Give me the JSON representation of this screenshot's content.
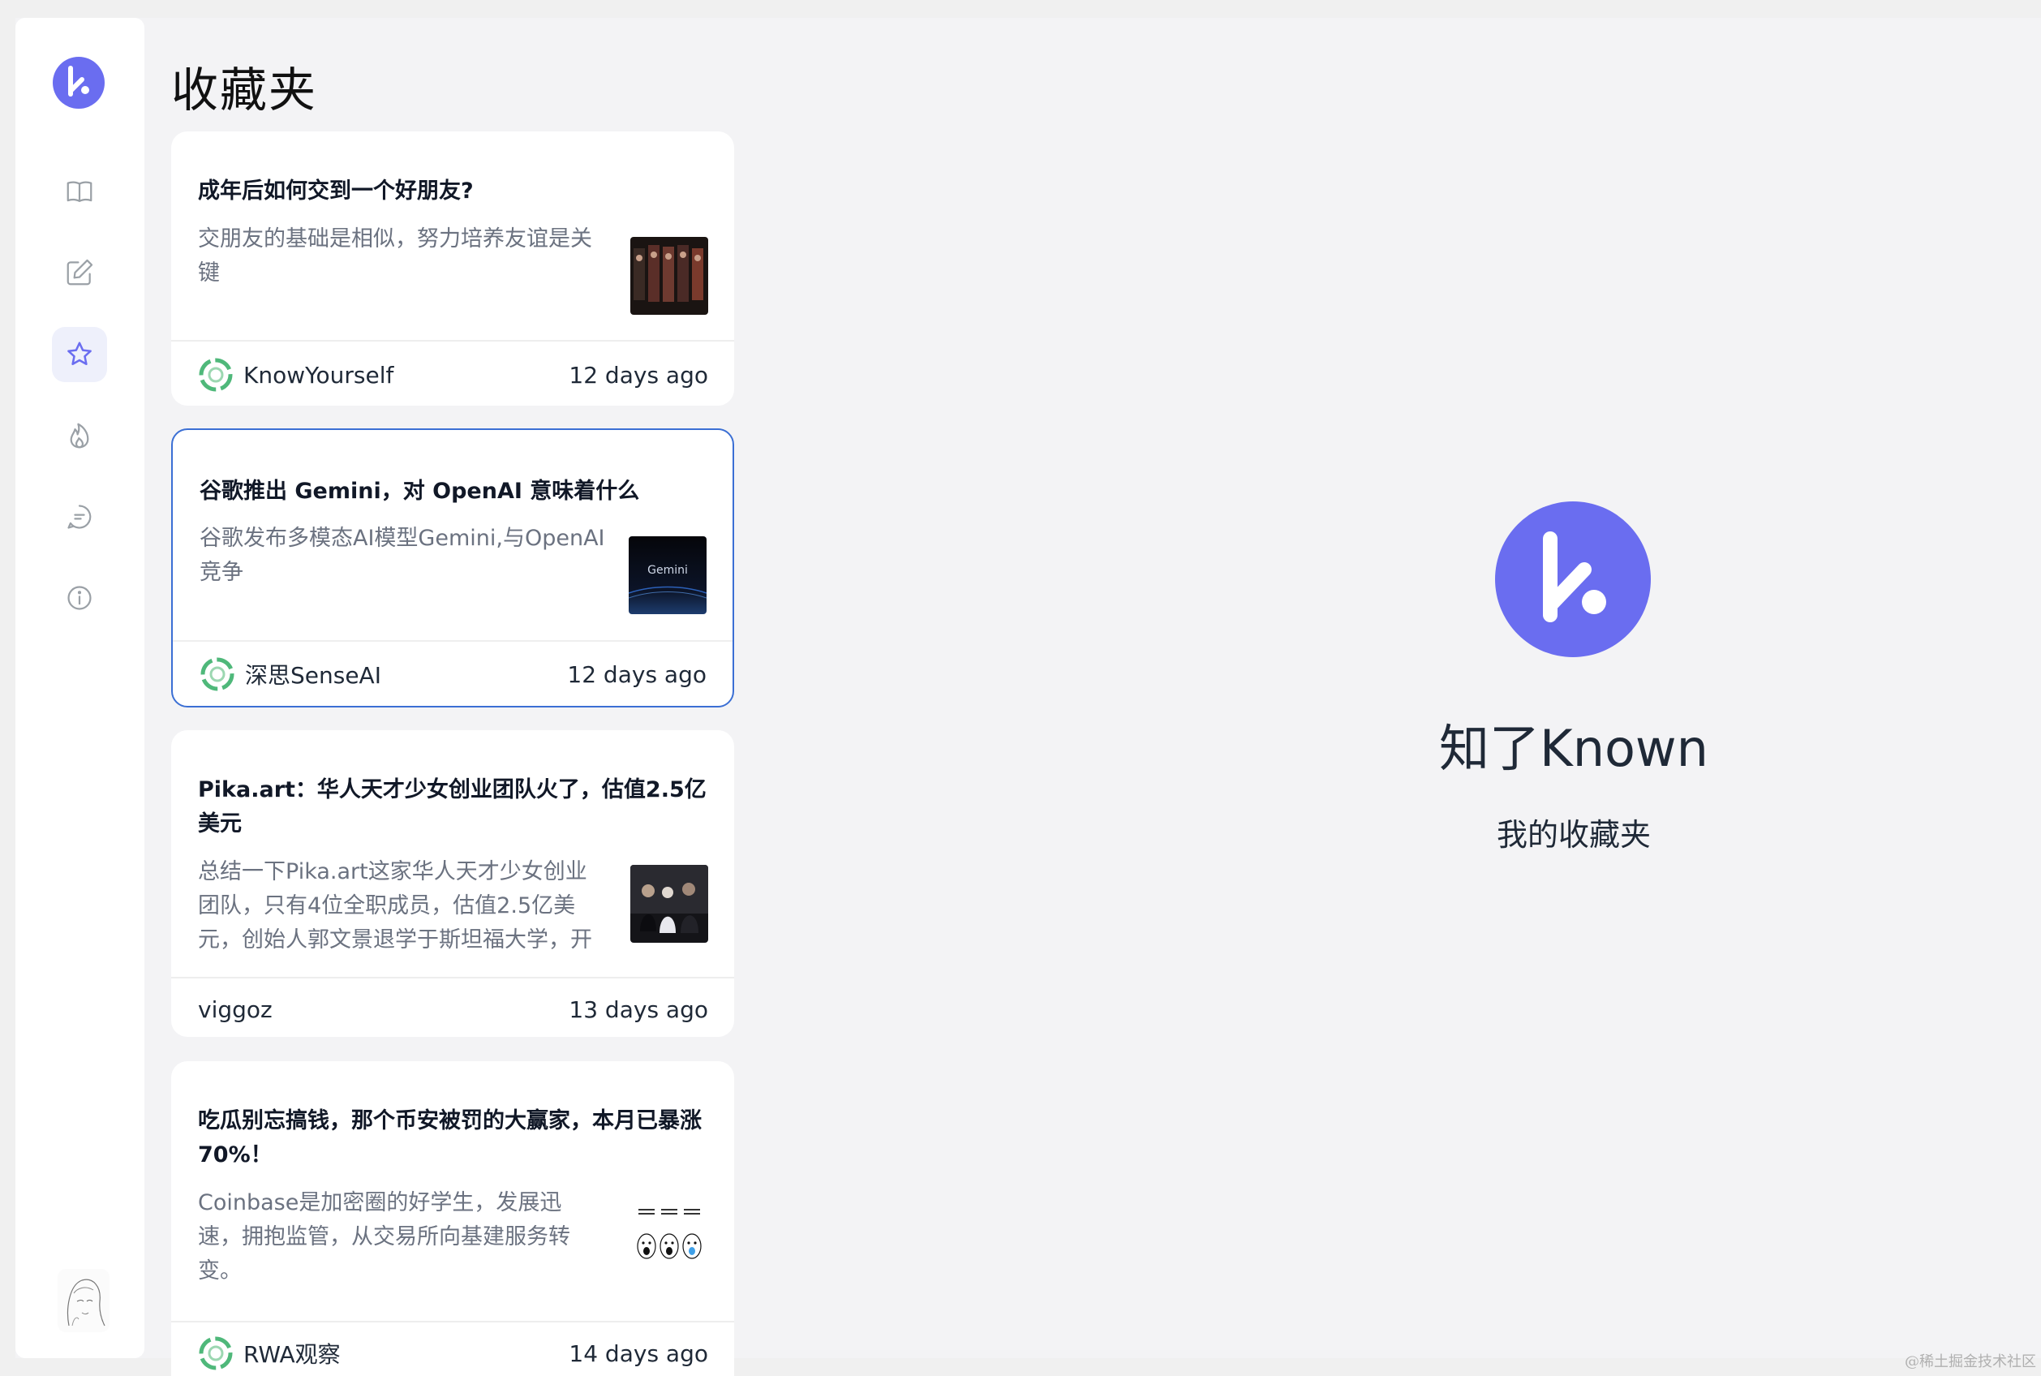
{
  "app": {
    "page_title": "收藏夹",
    "brand_name": "知了Known",
    "brand_subtitle": "我的收藏夹",
    "accent_color": "#6a6df0",
    "selected_border_color": "#3b6fd4"
  },
  "sidebar": {
    "items": [
      {
        "icon": "book-icon",
        "active": false
      },
      {
        "icon": "edit-icon",
        "active": false
      },
      {
        "icon": "star-icon",
        "active": true
      },
      {
        "icon": "fire-icon",
        "active": false
      },
      {
        "icon": "chat-icon",
        "active": false
      },
      {
        "icon": "info-icon",
        "active": false
      }
    ],
    "avatar": "user-avatar"
  },
  "cards": [
    {
      "title": "成年后如何交到一个好朋友?",
      "summary": "交朋友的基础是相似，努力培养友谊是关键",
      "source": "KnowYourself",
      "time": "12 days ago",
      "has_source_icon": true,
      "selected": false
    },
    {
      "title": "谷歌推出 Gemini，对 OpenAI 意味着什么",
      "summary": "谷歌发布多模态AI模型Gemini,与OpenAI竞争",
      "source": "深思SenseAI",
      "time": "12 days ago",
      "thumb_text": "Gemini",
      "has_source_icon": true,
      "selected": true
    },
    {
      "title": "Pika.art：华人天才少女创业团队火了，估值2.5亿美元",
      "summary": "总结一下Pika.art这家华人天才少女创业团队，只有4位全职成员，估值2.5亿美元，创始人郭文景退学于斯坦福大学，开",
      "source": "viggoz",
      "time": "13 days ago",
      "has_source_icon": false,
      "selected": false
    },
    {
      "title": "吃瓜别忘搞钱，那个币安被罚的大赢家，本月已暴涨70%！",
      "summary": "Coinbase是加密圈的好学生，发展迅速，拥抱监管，从交易所向基建服务转变。",
      "source": "RWA观察",
      "time": "14 days ago",
      "has_source_icon": true,
      "selected": false
    }
  ],
  "watermark": "@稀土掘金技术社区"
}
